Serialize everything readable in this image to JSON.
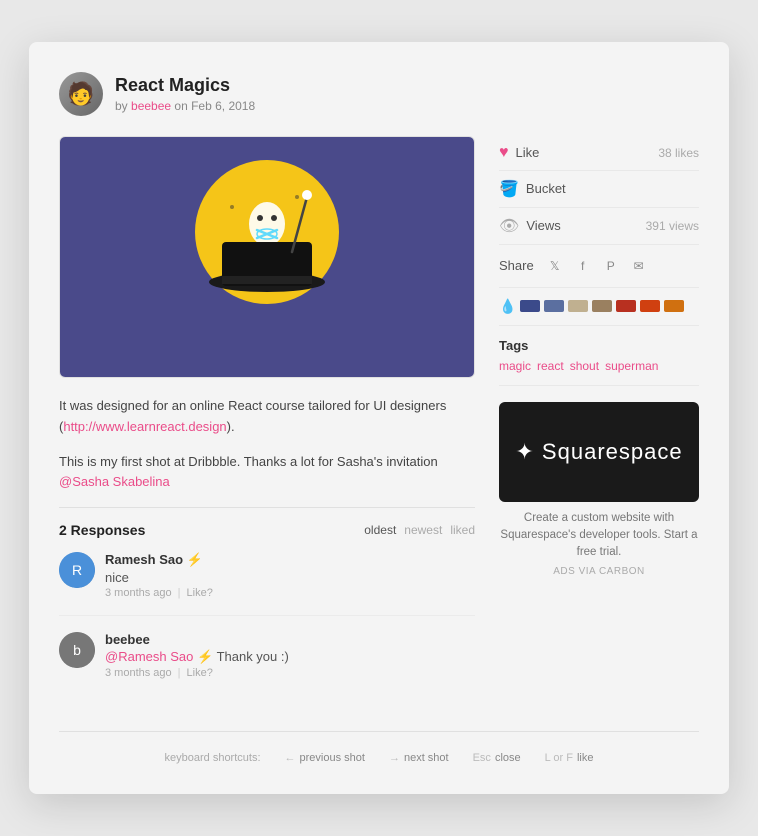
{
  "header": {
    "title": "React Magics",
    "author": "beebee",
    "date": "Feb 6, 2018"
  },
  "actions": {
    "like_label": "Like",
    "like_count": "38 likes",
    "bucket_label": "Bucket",
    "views_label": "Views",
    "views_count": "391 views",
    "share_label": "Share"
  },
  "colors": {
    "swatches": [
      "#3b4a8a",
      "#5b6fa0",
      "#c0b090",
      "#9a8060",
      "#b83020",
      "#d04010",
      "#d07010"
    ]
  },
  "tags": {
    "title": "Tags",
    "items": [
      "magic",
      "react",
      "shout",
      "superman"
    ]
  },
  "ad": {
    "logo": "✦ Squarespace",
    "text": "Create a custom website with Squarespace's developer tools. Start a free trial.",
    "via": "ADS VIA CARBON"
  },
  "description": {
    "line1": "It was designed for an online React course tailored for UI designers (",
    "link": "http://www.learnreact.design",
    "line1_end": ").",
    "line2_start": "This is my first shot at Dribbble. Thanks a lot for Sasha's invitation ",
    "mention": "@Sasha Skabelina"
  },
  "responses": {
    "title": "2 Responses",
    "sort_oldest": "oldest",
    "sort_newest": "newest",
    "sort_liked": "liked",
    "comments": [
      {
        "author": "Ramesh Sao",
        "emoji": "⚡",
        "text": "nice",
        "time": "3 months ago",
        "like": "Like?"
      },
      {
        "author": "beebee",
        "emoji": "",
        "mention": "@Ramesh Sao",
        "mention_emoji": "⚡",
        "text_after": " Thank you :)",
        "time": "3 months ago",
        "like": "Like?"
      }
    ]
  },
  "keyboard": {
    "label": "keyboard shortcuts:",
    "prev_key": "←",
    "prev_label": "previous shot",
    "next_key": "→",
    "next_label": "next shot",
    "close_key": "Esc",
    "close_label": "close",
    "like_key": "L or F",
    "like_label": "like"
  }
}
